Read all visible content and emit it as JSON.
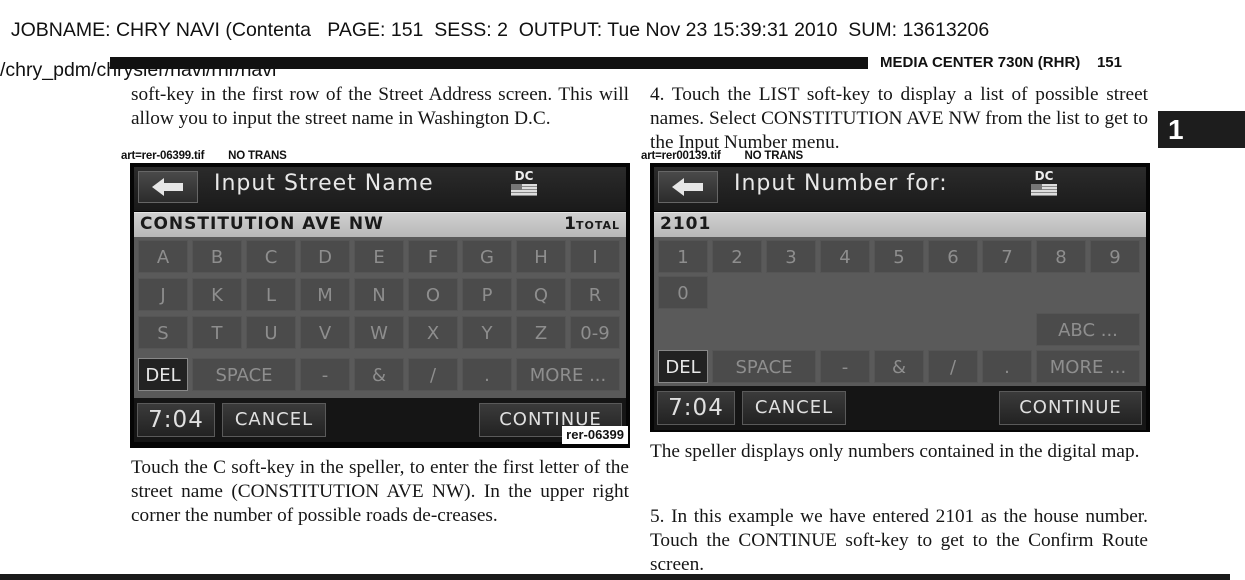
{
  "job_header": {
    "line1": "JOBNAME: CHRY NAVI (Contenta   PAGE: 151  SESS: 2  OUTPUT: Tue Nov 23 15:39:31 2010  SUM: 13613206",
    "line2": "/chry_pdm/chrysler/navi/rhr/navi"
  },
  "page_header": {
    "section_title": "MEDIA CENTER 730N (RHR)",
    "page_number": "151"
  },
  "chapter_tab": "1",
  "left_column": {
    "intro_text": "soft-key in the first row of the Street Address screen. This will allow you to input the street name in Washington D.C.",
    "art_label": "art=rer-06399.tif        NO TRANS",
    "screen": {
      "title": "Input Street Name",
      "state": "DC",
      "entry": "CONSTITUTION AVE NW",
      "count_number": "1",
      "count_label": "TOTAL",
      "keys": [
        "A",
        "B",
        "C",
        "D",
        "E",
        "F",
        "G",
        "H",
        "I",
        "J",
        "K",
        "L",
        "M",
        "N",
        "O",
        "P",
        "Q",
        "R",
        "S",
        "T",
        "U",
        "V",
        "W",
        "X",
        "Y",
        "Z",
        "0-9"
      ],
      "bottom_row": [
        "DEL",
        "SPACE",
        "-",
        "&",
        "/",
        ".",
        "MORE ..."
      ],
      "clock": "7:04",
      "cancel": "CANCEL",
      "continue": "CONTINUE",
      "art_id": "rer-06399"
    },
    "body_text": "Touch the C soft-key in the speller, to enter the first letter of the street name (CONSTITUTION AVE NW). In the upper right corner the number of possible roads de-creases."
  },
  "right_column": {
    "step4_text": "4. Touch the LIST soft-key to display a list of possible street names. Select CONSTITUTION AVE NW from the list to get to the Input Number menu.",
    "art_label": "art=rer00139.tif        NO TRANS",
    "screen": {
      "title": "Input Number for:",
      "state": "DC",
      "entry": "2101",
      "keys": [
        "1",
        "2",
        "3",
        "4",
        "5",
        "6",
        "7",
        "8",
        "9",
        "0"
      ],
      "abc_key": "ABC ...",
      "bottom_row": [
        "DEL",
        "SPACE",
        "-",
        "&",
        "/",
        ".",
        "MORE ..."
      ],
      "clock": "7:04",
      "cancel": "CANCEL",
      "continue": "CONTINUE"
    },
    "note_text": "The speller displays only numbers contained in the digital map.",
    "step5_text": "5. In this example we have entered 2101 as the house number. Touch the CONTINUE soft-key to get to the Confirm Route screen."
  }
}
